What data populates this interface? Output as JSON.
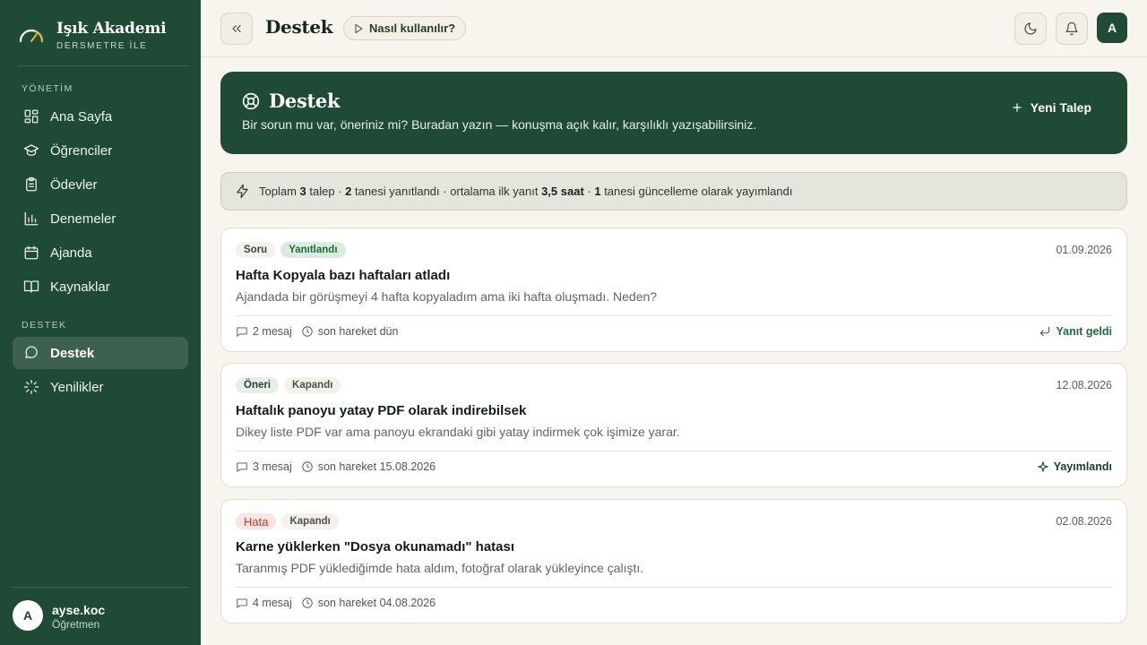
{
  "brand": {
    "title": "Işık Akademi",
    "subtitle": "DERSMETRE İLE"
  },
  "sidebar": {
    "sections": [
      {
        "label": "YÖNETİM",
        "items": [
          {
            "label": "Ana Sayfa",
            "icon": "dashboard-grid-icon"
          },
          {
            "label": "Öğrenciler",
            "icon": "graduation-cap-icon"
          },
          {
            "label": "Ödevler",
            "icon": "clipboard-icon"
          },
          {
            "label": "Denemeler",
            "icon": "bar-chart-icon"
          },
          {
            "label": "Ajanda",
            "icon": "calendar-icon"
          },
          {
            "label": "Kaynaklar",
            "icon": "book-open-icon"
          }
        ]
      },
      {
        "label": "DESTEK",
        "items": [
          {
            "label": "Destek",
            "icon": "chat-bubble-icon",
            "active": true
          },
          {
            "label": "Yenilikler",
            "icon": "sparkle-burst-icon"
          }
        ]
      }
    ]
  },
  "user": {
    "initial": "A",
    "name": "ayse.koc",
    "role": "Öğretmen"
  },
  "topbar": {
    "title": "Destek",
    "how_label": "Nasıl kullanılır?",
    "avatar_initial": "A"
  },
  "hero": {
    "title": "Destek",
    "description": "Bir sorun mu var, öneriniz mi? Buradan yazın — konuşma açık kalır, karşılıklı yazışabilirsiniz.",
    "new_button": "Yeni Talep"
  },
  "stats": {
    "prefix": "Toplam ",
    "total": "3",
    "t1": " talep · ",
    "answered": "2",
    "t2": " tanesi yanıtlandı · ortalama ilk yanıt ",
    "avg": "3,5 saat",
    "t3": " · ",
    "published": "1",
    "t4": " tanesi güncelleme olarak yayımlandı"
  },
  "tickets": [
    {
      "type": "Soru",
      "status": "Yanıtlandı",
      "date": "01.09.2026",
      "title": "Hafta Kopyala bazı haftaları atladı",
      "description": "Ajandada bir görüşmeyi 4 hafta kopyaladım ama iki hafta oluşmadı. Neden?",
      "messages": "2 mesaj",
      "last_activity": "son hareket dün",
      "flag": "Yanıt geldi"
    },
    {
      "type": "Öneri",
      "status": "Kapandı",
      "date": "12.08.2026",
      "title": "Haftalık panoyu yatay PDF olarak indirebilsek",
      "description": "Dikey liste PDF var ama panoyu ekrandaki gibi yatay indirmek çok işimize yarar.",
      "messages": "3 mesaj",
      "last_activity": "son hareket 15.08.2026",
      "flag": "Yayımlandı"
    },
    {
      "type": "Hata",
      "status": "Kapandı",
      "date": "02.08.2026",
      "title": "Karne yüklerken \"Dosya okunamadı\" hatası",
      "description": "Taranmış PDF yüklediğimde hata aldım, fotoğraf olarak yükleyince çalıştı.",
      "messages": "4 mesaj",
      "last_activity": "son hareket 04.08.2026",
      "flag": ""
    }
  ],
  "colors": {
    "brand_green": "#1f4a36",
    "page_bg": "#f7f5ee",
    "success_green": "#1f6b40",
    "error_red": "#b43d35"
  }
}
